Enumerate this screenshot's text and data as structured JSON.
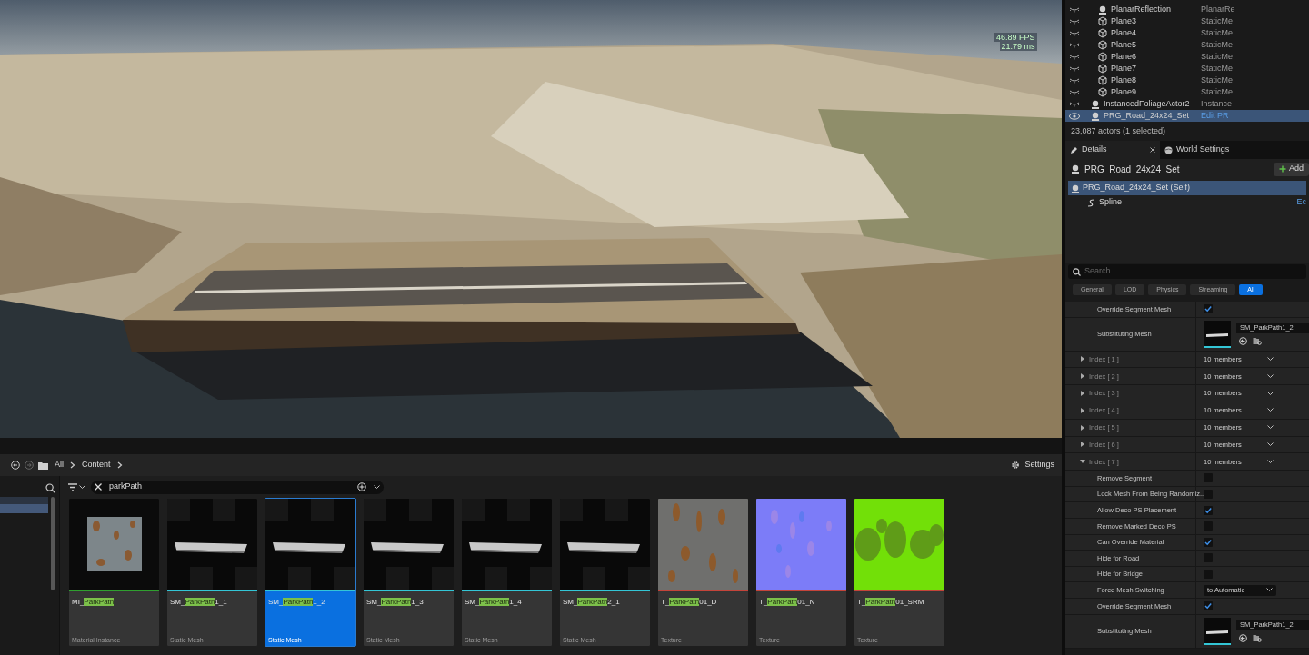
{
  "viewport": {
    "fps": "46.89 FPS",
    "frame_time": "21.79 ms"
  },
  "outliner": {
    "items": [
      {
        "children": [
          {
            "label": "PlanarReflection",
            "type": "PlanarRe",
            "kind": "actor",
            "visible": false,
            "selected": false
          },
          {
            "label": "Plane3",
            "type": "StaticMe",
            "kind": "mesh",
            "visible": false,
            "selected": false
          },
          {
            "label": "Plane4",
            "type": "StaticMe",
            "kind": "mesh",
            "visible": false,
            "selected": false
          },
          {
            "label": "Plane5",
            "type": "StaticMe",
            "kind": "mesh",
            "visible": false,
            "selected": false
          },
          {
            "label": "Plane6",
            "type": "StaticMe",
            "kind": "mesh",
            "visible": false,
            "selected": false
          },
          {
            "label": "Plane7",
            "type": "StaticMe",
            "kind": "mesh",
            "visible": false,
            "selected": false
          },
          {
            "label": "Plane8",
            "type": "StaticMe",
            "kind": "mesh",
            "visible": false,
            "selected": false
          },
          {
            "label": "Plane9",
            "type": "StaticMe",
            "kind": "mesh",
            "visible": false,
            "selected": false
          }
        ]
      },
      {
        "label": "InstancedFoliageActor2",
        "type": "Instance",
        "kind": "actor",
        "visible": false,
        "selected": false
      },
      {
        "label": "PRG_Road_24x24_Set",
        "type": "Edit PR",
        "kind": "actor",
        "visible": true,
        "selected": true
      }
    ],
    "status": "23,087 actors (1 selected)"
  },
  "details": {
    "tabs": [
      {
        "label": "Details",
        "selected": true,
        "closable": true
      },
      {
        "label": "World Settings",
        "selected": false,
        "closable": false
      }
    ],
    "actor": "PRG_Road_24x24_Set",
    "add_button": "Add",
    "components": [
      {
        "label": "PRG_Road_24x24_Set (Self)",
        "selected": true,
        "children": [
          {
            "label": "Spline",
            "selected": false,
            "action": "Ec"
          }
        ]
      }
    ],
    "search": {
      "placeholder": "Search"
    },
    "filters": [
      {
        "label": "General",
        "selected": false
      },
      {
        "label": "LOD",
        "selected": false
      },
      {
        "label": "Physics",
        "selected": false
      },
      {
        "label": "Streaming",
        "selected": false
      },
      {
        "label": "All",
        "selected": true
      }
    ],
    "properties": [
      {
        "kind": "continued",
        "children": [
          {
            "kind": "checkbox",
            "label": "Override Segment Mesh",
            "checked": true
          },
          {
            "kind": "mesh",
            "label": "Substituting Mesh",
            "value": "SM_ParkPath1_2"
          }
        ]
      },
      {
        "kind": "group",
        "label": "Index [ 1 ]",
        "value": "10 members",
        "expanded": false
      },
      {
        "kind": "group",
        "label": "Index [ 2 ]",
        "value": "10 members",
        "expanded": false
      },
      {
        "kind": "group",
        "label": "Index [ 3 ]",
        "value": "10 members",
        "expanded": false
      },
      {
        "kind": "group",
        "label": "Index [ 4 ]",
        "value": "10 members",
        "expanded": false
      },
      {
        "kind": "group",
        "label": "Index [ 5 ]",
        "value": "10 members",
        "expanded": false
      },
      {
        "kind": "group",
        "label": "Index [ 6 ]",
        "value": "10 members",
        "expanded": false
      },
      {
        "kind": "group",
        "label": "Index [ 7 ]",
        "value": "10 members",
        "expanded": true,
        "children": [
          {
            "kind": "checkbox",
            "label": "Remove Segment",
            "checked": false
          },
          {
            "kind": "checkbox",
            "label": "Lock Mesh From Being Randomiz...",
            "checked": false
          },
          {
            "kind": "checkbox",
            "label": "Allow Deco PS Placement",
            "checked": true
          },
          {
            "kind": "checkbox",
            "label": "Remove Marked Deco PS",
            "checked": false
          },
          {
            "kind": "checkbox",
            "label": "Can Override Material",
            "checked": true
          },
          {
            "kind": "checkbox",
            "label": "Hide for Road",
            "checked": false
          },
          {
            "kind": "checkbox",
            "label": "Hide for Bridge",
            "checked": false
          },
          {
            "kind": "dropdown",
            "label": "Force Mesh Switching",
            "value": "to Automatic"
          },
          {
            "kind": "checkbox",
            "label": "Override Segment Mesh",
            "checked": true
          },
          {
            "kind": "mesh",
            "label": "Substituting Mesh",
            "value": "SM_ParkPath1_2"
          }
        ]
      }
    ]
  },
  "content_browser": {
    "path": [
      "All",
      "Content"
    ],
    "settings": "Settings",
    "search": {
      "value": "parkPath"
    },
    "assets": [
      {
        "prefix": "MI_",
        "match": "ParkPath",
        "type": "Material Instance",
        "color": "#2fa02f",
        "kind": "material",
        "selected": false
      },
      {
        "prefix": "SM_",
        "match": "ParkPath",
        "suffix": "1_1",
        "type": "Static Mesh",
        "color": "#33c6d6",
        "kind": "mesh",
        "selected": false
      },
      {
        "prefix": "SM_",
        "match": "ParkPath",
        "suffix": "1_2",
        "type": "Static Mesh",
        "color": "#33c6d6",
        "kind": "mesh",
        "selected": true
      },
      {
        "prefix": "SM_",
        "match": "ParkPath",
        "suffix": "1_3",
        "type": "Static Mesh",
        "color": "#33c6d6",
        "kind": "mesh",
        "selected": false
      },
      {
        "prefix": "SM_",
        "match": "ParkPath",
        "suffix": "1_4",
        "type": "Static Mesh",
        "color": "#33c6d6",
        "kind": "mesh",
        "selected": false
      },
      {
        "prefix": "SM_",
        "match": "ParkPath",
        "suffix": "2_1",
        "type": "Static Mesh",
        "color": "#33c6d6",
        "kind": "mesh",
        "selected": false
      },
      {
        "prefix": "T_",
        "match": "ParkPath",
        "suffix": "01_D",
        "type": "Texture",
        "color": "#c4443a",
        "kind": "diffuse",
        "selected": false
      },
      {
        "prefix": "T_",
        "match": "ParkPath",
        "suffix": "01_N",
        "type": "Texture",
        "color": "#c4443a",
        "kind": "normal",
        "selected": false
      },
      {
        "prefix": "T_",
        "match": "ParkPath",
        "suffix": "01_SRM",
        "type": "Texture",
        "color": "#c4443a",
        "kind": "srm",
        "selected": false
      }
    ]
  }
}
